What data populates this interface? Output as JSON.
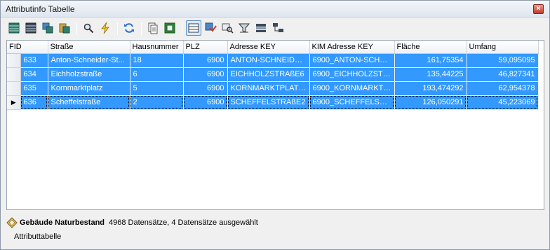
{
  "window": {
    "title": "Attributinfo Tabelle",
    "close_label": "×"
  },
  "toolbar": {
    "buttons": [
      {
        "icon": "table-select-all-icon",
        "label": "Alle auswählen"
      },
      {
        "icon": "table-icon",
        "label": "Tabelle"
      },
      {
        "icon": "copy-table-icon",
        "label": "Kopieren"
      },
      {
        "icon": "paste-table-icon",
        "label": "Einfügen"
      },
      {
        "icon": "zoom-icon",
        "label": "Zoom"
      },
      {
        "icon": "flash-icon",
        "label": "Aufblitzen"
      },
      {
        "icon": "refresh-icon",
        "label": "Aktualisieren"
      },
      {
        "icon": "document-icon",
        "label": "Dokument"
      },
      {
        "icon": "export-icon",
        "label": "Export"
      },
      {
        "icon": "field-layout-icon",
        "label": "Felder"
      },
      {
        "icon": "filter-table-icon",
        "label": "Filter"
      },
      {
        "icon": "search-table-icon",
        "label": "Suchen"
      },
      {
        "icon": "funnel-icon",
        "label": "Trichter"
      },
      {
        "icon": "list-icon",
        "label": "Liste"
      },
      {
        "icon": "relation-icon",
        "label": "Relation"
      }
    ]
  },
  "table": {
    "columns": [
      "FID",
      "Straße",
      "Hausnummer",
      "PLZ",
      "Adresse KEY",
      "KIM Adresse KEY",
      "Fläche",
      "Umfang"
    ],
    "rows": [
      {
        "fid": "633",
        "strasse": "Anton-Schneider-St...",
        "hausnummer": "18",
        "plz": "6900",
        "adresse_key": "ANTON-SCHNEIDER...",
        "kim_key": "6900_ANTON-SCHN...",
        "flaeche": "161,75354",
        "umfang": "59,095095",
        "selected": true,
        "current": false
      },
      {
        "fid": "634",
        "strasse": "Eichholzstraße",
        "hausnummer": "6",
        "plz": "6900",
        "adresse_key": "EICHHOLZSTRAßE6",
        "kim_key": "6900_EICHHOLZSTR...",
        "flaeche": "135,44225",
        "umfang": "46,827341",
        "selected": true,
        "current": false
      },
      {
        "fid": "635",
        "strasse": "Kornmarktplatz",
        "hausnummer": "5",
        "plz": "6900",
        "adresse_key": "KORNMARKTPLATZ5",
        "kim_key": "6900_KORNMARKTP...",
        "flaeche": "193,474292",
        "umfang": "62,954378",
        "selected": true,
        "current": false
      },
      {
        "fid": "636",
        "strasse": "Scheffelstraße",
        "hausnummer": "2",
        "plz": "6900",
        "adresse_key": "SCHEFFELSTRAßE2",
        "kim_key": "6900_SCHEFFELSTR...",
        "flaeche": "126,050291",
        "umfang": "45,223069",
        "selected": true,
        "current": true
      }
    ],
    "current_row_marker": "▶"
  },
  "status": {
    "layer_name": "Gebäude Naturbestand",
    "summary": "4968 Datensätze, 4 Datensätze ausgewählt"
  },
  "bottom_tab": {
    "label": "Attributtabelle"
  },
  "colors": {
    "selection": "#3399ff",
    "title_bar": "#dfe6ef",
    "close_button": "#c0392b"
  }
}
